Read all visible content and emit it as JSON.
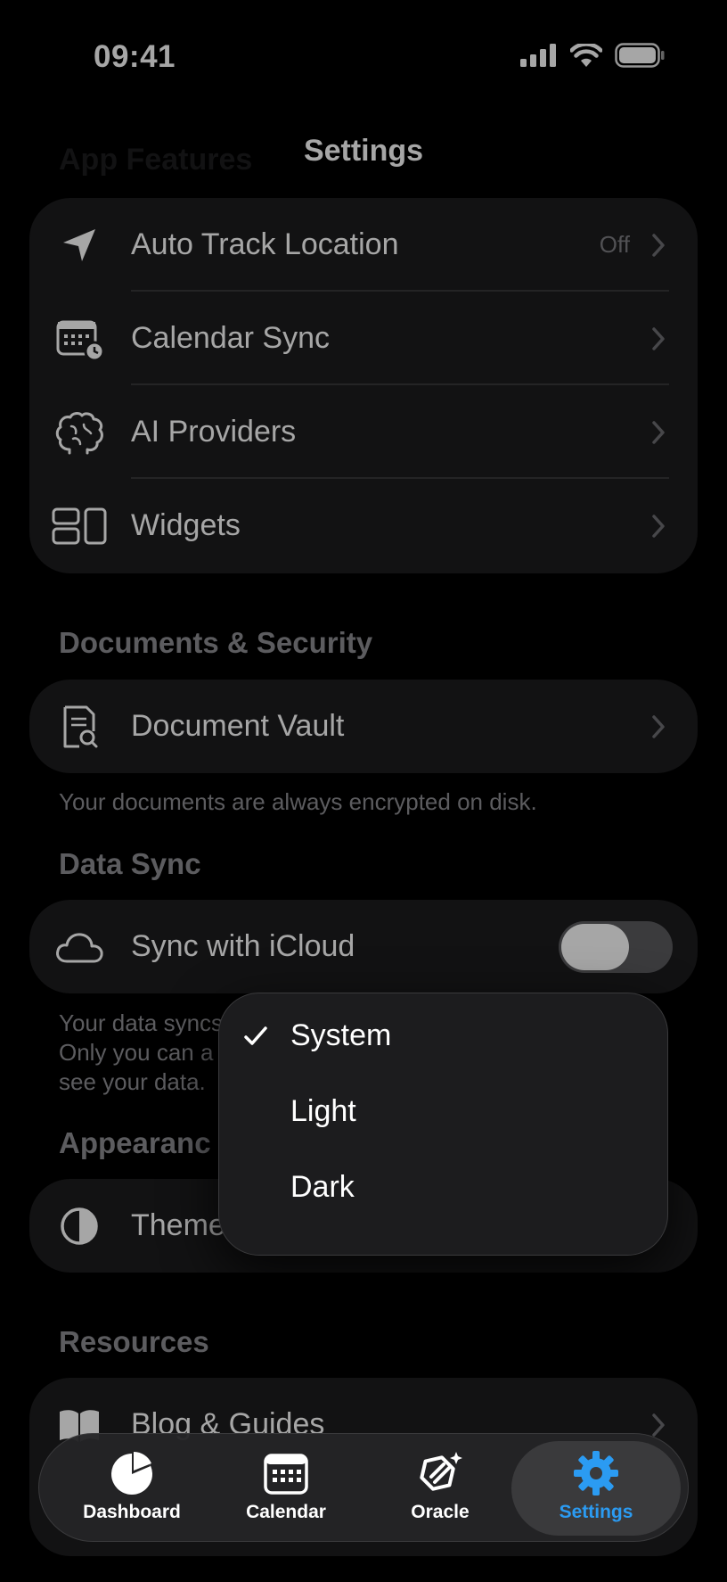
{
  "status_bar": {
    "time": "09:41"
  },
  "nav": {
    "title": "Settings"
  },
  "app_features": {
    "items": [
      {
        "label": "Auto Track Location",
        "value": "Off"
      },
      {
        "label": "Calendar Sync"
      },
      {
        "label": "AI Providers"
      },
      {
        "label": "Widgets"
      }
    ]
  },
  "documents_security": {
    "header": "Documents & Security",
    "items": [
      {
        "label": "Document Vault"
      }
    ],
    "footnote": "Your documents are always encrypted on disk."
  },
  "data_sync": {
    "header": "Data Sync",
    "items": [
      {
        "label": "Sync with iCloud",
        "on": true
      }
    ],
    "footnote_lines": [
      "Your data syncs",
      "Only you can a",
      "see your data."
    ]
  },
  "appearance": {
    "header": "Appearanc",
    "items": [
      {
        "label": "Theme"
      }
    ]
  },
  "theme_menu": {
    "options": [
      {
        "label": "System",
        "selected": true
      },
      {
        "label": "Light",
        "selected": false
      },
      {
        "label": "Dark",
        "selected": false
      }
    ]
  },
  "resources": {
    "header": "Resources",
    "items": [
      {
        "label": "Blog & Guides"
      }
    ]
  },
  "tab_bar": {
    "tabs": [
      {
        "label": "Dashboard",
        "active": false
      },
      {
        "label": "Calendar",
        "active": false
      },
      {
        "label": "Oracle",
        "active": false
      },
      {
        "label": "Settings",
        "active": true
      }
    ],
    "active_color": "#2b9bf2"
  }
}
